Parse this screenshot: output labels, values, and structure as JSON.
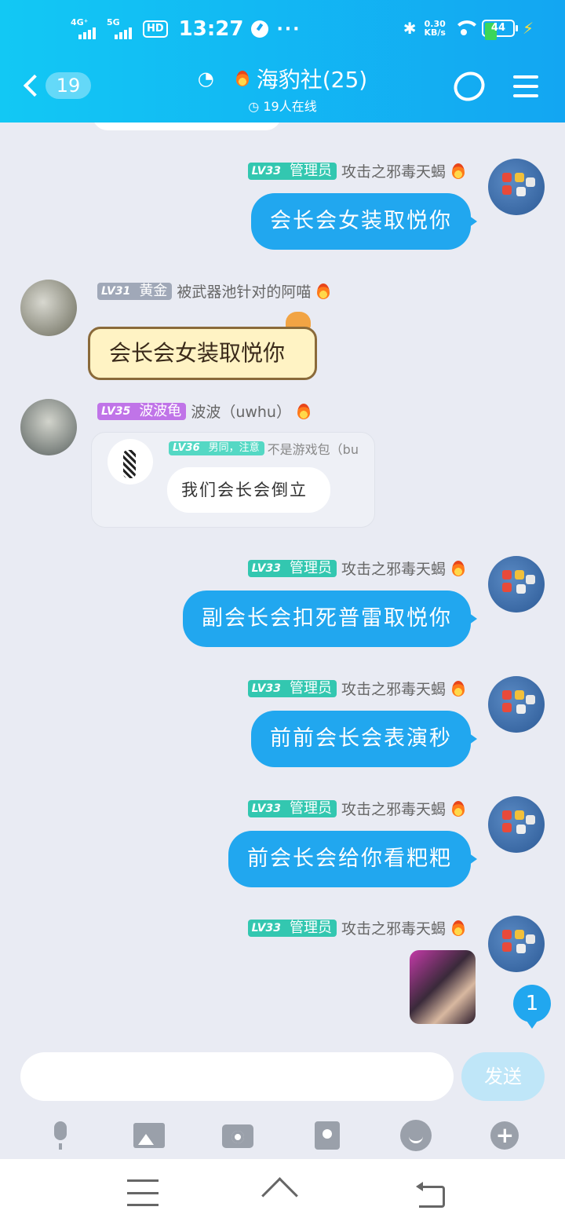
{
  "status_bar": {
    "signal1": "4G⁺",
    "signal2": "5G",
    "hd": "HD",
    "time": "13:27",
    "more": "···",
    "net_speed_value": "0.30",
    "net_speed_unit": "KB/s",
    "battery": "44",
    "battery_level": 0.44
  },
  "header": {
    "back_badge": "19",
    "group_name": "海豹社(25)",
    "online": "19人在线"
  },
  "messages": [
    {
      "level": "LV33",
      "role": "管理员",
      "name": "攻击之邪毒天蝎",
      "text": "会长会女装取悦你"
    },
    {
      "level": "LV31",
      "role": "黄金",
      "name": "被武器池针对的阿喵",
      "text": "会长会女装取悦你"
    },
    {
      "level": "LV35",
      "role": "波波龟",
      "name": "波波（uwhu）",
      "quote": {
        "level": "LV36",
        "role": "男同，注意",
        "name": "不是游戏包（bu",
        "text": "我们会长会倒立"
      }
    },
    {
      "level": "LV33",
      "role": "管理员",
      "name": "攻击之邪毒天蝎",
      "text": "副会长会扣死普雷取悦你"
    },
    {
      "level": "LV33",
      "role": "管理员",
      "name": "攻击之邪毒天蝎",
      "text": "前前会长会表演秒"
    },
    {
      "level": "LV33",
      "role": "管理员",
      "name": "攻击之邪毒天蝎",
      "text": "前会长会给你看粑粑"
    },
    {
      "level": "LV33",
      "role": "管理员",
      "name": "攻击之邪毒天蝎"
    }
  ],
  "unread_count": "1",
  "input": {
    "placeholder": "",
    "send_label": "发送"
  }
}
